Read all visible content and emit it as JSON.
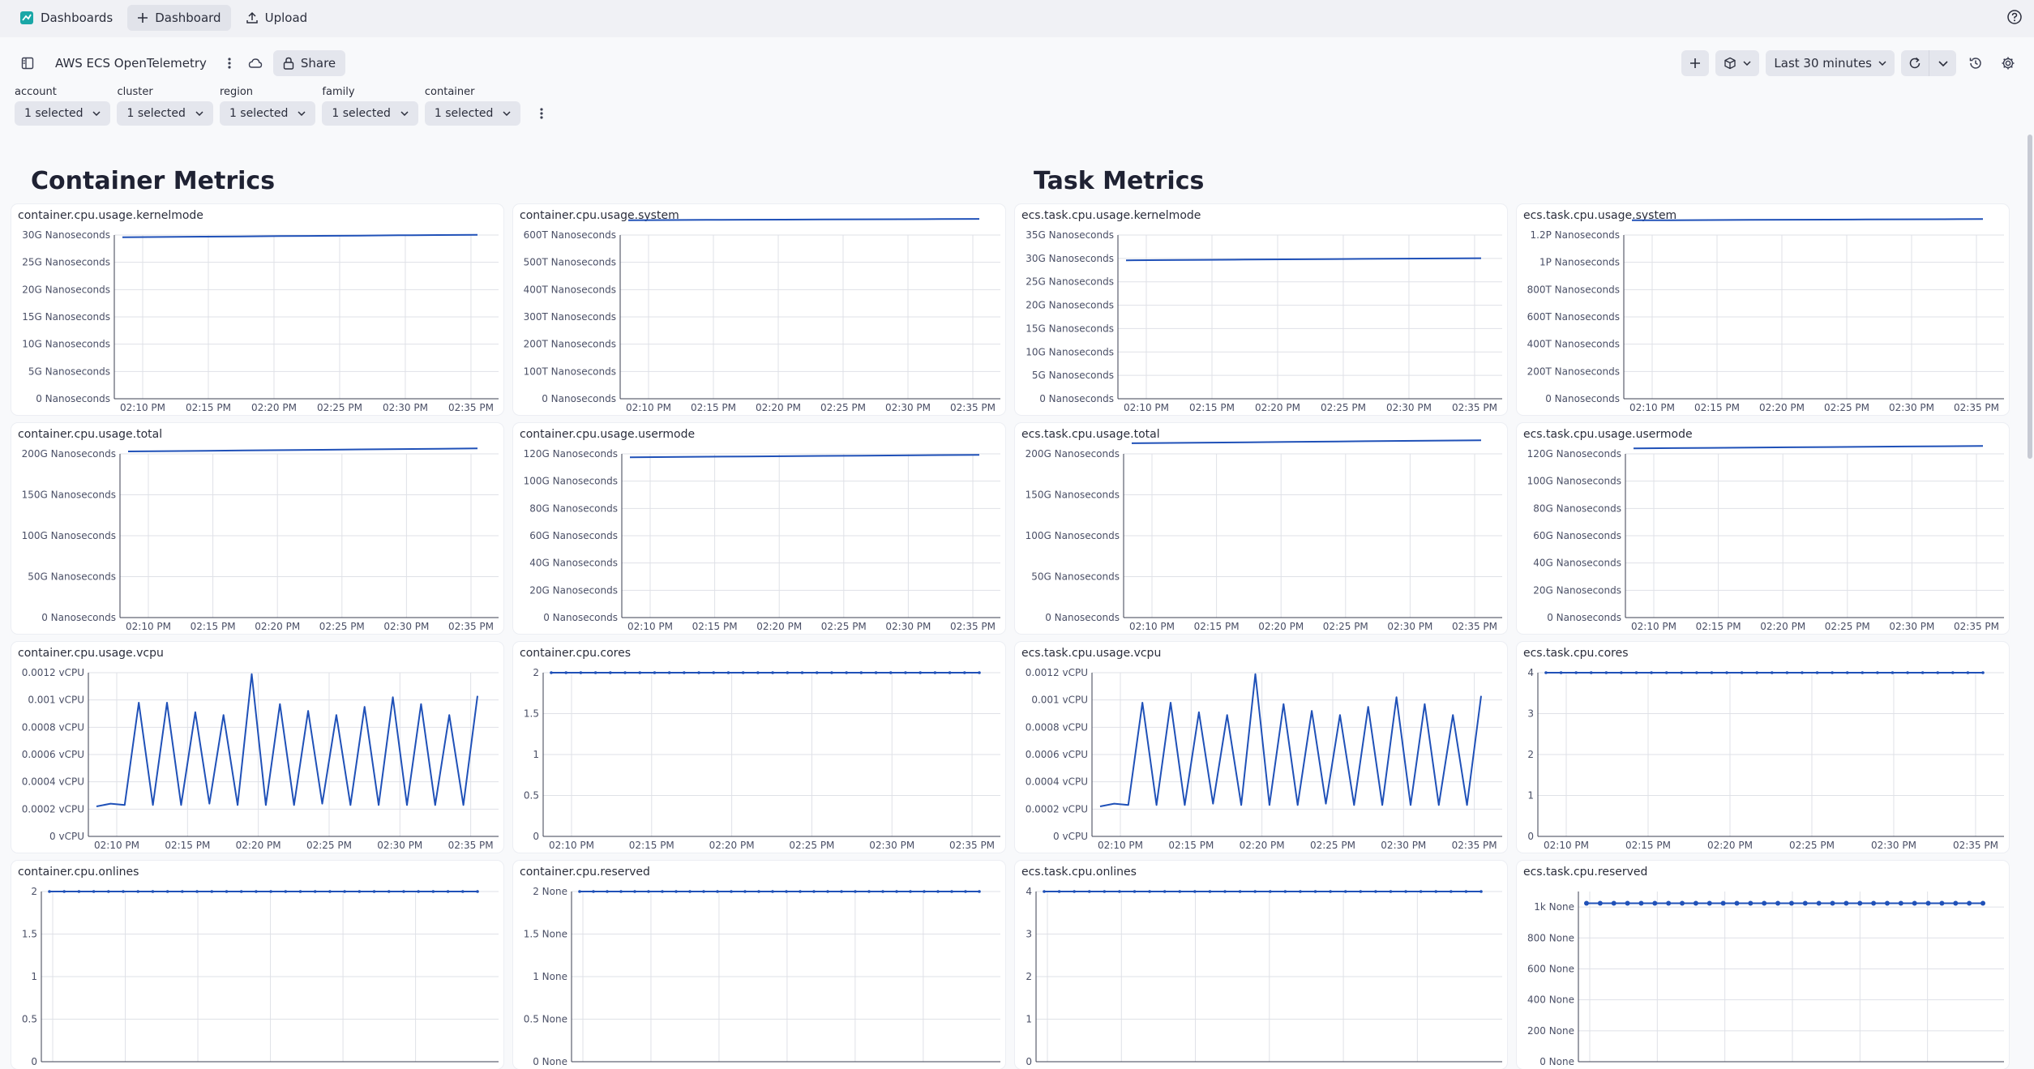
{
  "topbar": {
    "app_label": "Dashboards",
    "new_dashboard_label": "Dashboard",
    "upload_label": "Upload"
  },
  "dashboard": {
    "title": "AWS ECS OpenTelemetry",
    "share_label": "Share",
    "timeframe_label": "Last 30 minutes"
  },
  "variables": [
    {
      "name": "account",
      "value": "1 selected"
    },
    {
      "name": "cluster",
      "value": "1 selected"
    },
    {
      "name": "region",
      "value": "1 selected"
    },
    {
      "name": "family",
      "value": "1 selected"
    },
    {
      "name": "container",
      "value": "1 selected"
    }
  ],
  "sections": {
    "container": "Container Metrics",
    "task": "Task Metrics"
  },
  "colors": {
    "series": "#2051b8",
    "grid": "#dfe1e7",
    "axis": "#3b3f52",
    "label": "#4a4f66"
  },
  "chart_data": [
    {
      "id": "c1",
      "title": "container.cpu.usage.kernelmode",
      "type": "line",
      "xmode": "std",
      "ylim": [
        0,
        30
      ],
      "yticks": [
        0,
        5,
        10,
        15,
        20,
        25,
        30
      ],
      "ytick_labels": [
        "0 Nanoseconds",
        "5G Nanoseconds",
        "10G Nanoseconds",
        "15G Nanoseconds",
        "20G Nanoseconds",
        "25G Nanoseconds",
        "30G Nanoseconds"
      ],
      "xtick_labels": [
        "02:10 PM",
        "02:15 PM",
        "02:20 PM",
        "02:25 PM",
        "02:30 PM",
        "02:35 PM"
      ],
      "series": [
        {
          "values": [
            29.6,
            29.65,
            29.7,
            29.75,
            29.8,
            29.85,
            29.9,
            29.95,
            30.0,
            30.05
          ]
        }
      ]
    },
    {
      "id": "c2",
      "title": "container.cpu.usage.system",
      "type": "line",
      "xmode": "std",
      "ylim": [
        0,
        600
      ],
      "yticks": [
        0,
        100,
        200,
        300,
        400,
        500,
        600
      ],
      "ytick_labels": [
        "0 Nanoseconds",
        "100T Nanoseconds",
        "200T Nanoseconds",
        "300T Nanoseconds",
        "400T Nanoseconds",
        "500T Nanoseconds",
        "600T Nanoseconds"
      ],
      "xtick_labels": [
        "02:10 PM",
        "02:15 PM",
        "02:20 PM",
        "02:25 PM",
        "02:30 PM",
        "02:35 PM"
      ],
      "series": [
        {
          "values": [
            654,
            655,
            655.5,
            656,
            656.5,
            657,
            657.5,
            658,
            658.5,
            659
          ]
        }
      ]
    },
    {
      "id": "t1",
      "title": "ecs.task.cpu.usage.kernelmode",
      "type": "line",
      "xmode": "std",
      "ylim": [
        0,
        35
      ],
      "yticks": [
        0,
        5,
        10,
        15,
        20,
        25,
        30,
        35
      ],
      "ytick_labels": [
        "0 Nanoseconds",
        "5G Nanoseconds",
        "10G Nanoseconds",
        "15G Nanoseconds",
        "20G Nanoseconds",
        "25G Nanoseconds",
        "30G Nanoseconds",
        "35G Nanoseconds"
      ],
      "xtick_labels": [
        "02:10 PM",
        "02:15 PM",
        "02:20 PM",
        "02:25 PM",
        "02:30 PM",
        "02:35 PM"
      ],
      "series": [
        {
          "values": [
            29.6,
            29.65,
            29.7,
            29.75,
            29.8,
            29.85,
            29.9,
            29.95,
            30.0,
            30.05
          ]
        }
      ]
    },
    {
      "id": "t2",
      "title": "ecs.task.cpu.usage.system",
      "type": "line",
      "xmode": "std",
      "ylim": [
        0,
        1200
      ],
      "yticks": [
        0,
        200,
        400,
        600,
        800,
        1000,
        1200
      ],
      "ytick_labels": [
        "0 Nanoseconds",
        "200T Nanoseconds",
        "400T Nanoseconds",
        "600T Nanoseconds",
        "800T Nanoseconds",
        "1P Nanoseconds",
        "1.2P Nanoseconds"
      ],
      "xtick_labels": [
        "02:10 PM",
        "02:15 PM",
        "02:20 PM",
        "02:25 PM",
        "02:30 PM",
        "02:35 PM"
      ],
      "series": [
        {
          "values": [
            1308,
            1309,
            1310,
            1311,
            1312,
            1313,
            1314,
            1315,
            1316,
            1317
          ]
        }
      ]
    },
    {
      "id": "c3",
      "title": "container.cpu.usage.total",
      "type": "line",
      "xmode": "std",
      "ylim": [
        0,
        200
      ],
      "yticks": [
        0,
        50,
        100,
        150,
        200
      ],
      "ytick_labels": [
        "0 Nanoseconds",
        "50G Nanoseconds",
        "100G Nanoseconds",
        "150G Nanoseconds",
        "200G Nanoseconds"
      ],
      "xtick_labels": [
        "02:10 PM",
        "02:15 PM",
        "02:20 PM",
        "02:25 PM",
        "02:30 PM",
        "02:35 PM"
      ],
      "series": [
        {
          "values": [
            203,
            203.4,
            203.8,
            204.2,
            204.6,
            205,
            205.4,
            205.8,
            206.2,
            206.6
          ]
        }
      ]
    },
    {
      "id": "c4",
      "title": "container.cpu.usage.usermode",
      "type": "line",
      "xmode": "std",
      "ylim": [
        0,
        120
      ],
      "yticks": [
        0,
        20,
        40,
        60,
        80,
        100,
        120
      ],
      "ytick_labels": [
        "0 Nanoseconds",
        "20G Nanoseconds",
        "40G Nanoseconds",
        "60G Nanoseconds",
        "80G Nanoseconds",
        "100G Nanoseconds",
        "120G Nanoseconds"
      ],
      "xtick_labels": [
        "02:10 PM",
        "02:15 PM",
        "02:20 PM",
        "02:25 PM",
        "02:30 PM",
        "02:35 PM"
      ],
      "series": [
        {
          "values": [
            117.5,
            117.7,
            117.9,
            118.1,
            118.3,
            118.5,
            118.7,
            118.9,
            119.1,
            119.3
          ]
        }
      ]
    },
    {
      "id": "t3",
      "title": "ecs.task.cpu.usage.total",
      "type": "line",
      "xmode": "std",
      "ylim": [
        0,
        200
      ],
      "yticks": [
        0,
        50,
        100,
        150,
        200
      ],
      "ytick_labels": [
        "0 Nanoseconds",
        "50G Nanoseconds",
        "100G Nanoseconds",
        "150G Nanoseconds",
        "200G Nanoseconds"
      ],
      "xtick_labels": [
        "02:10 PM",
        "02:15 PM",
        "02:20 PM",
        "02:25 PM",
        "02:30 PM",
        "02:35 PM"
      ],
      "series": [
        {
          "values": [
            213,
            213.4,
            213.8,
            214.2,
            214.6,
            215,
            215.4,
            215.8,
            216.2,
            216.6
          ]
        }
      ]
    },
    {
      "id": "t4",
      "title": "ecs.task.cpu.usage.usermode",
      "type": "line",
      "xmode": "std",
      "ylim": [
        0,
        120
      ],
      "yticks": [
        0,
        20,
        40,
        60,
        80,
        100,
        120
      ],
      "ytick_labels": [
        "0 Nanoseconds",
        "20G Nanoseconds",
        "40G Nanoseconds",
        "60G Nanoseconds",
        "80G Nanoseconds",
        "100G Nanoseconds",
        "120G Nanoseconds"
      ],
      "xtick_labels": [
        "02:10 PM",
        "02:15 PM",
        "02:20 PM",
        "02:25 PM",
        "02:30 PM",
        "02:35 PM"
      ],
      "series": [
        {
          "values": [
            124,
            124.2,
            124.4,
            124.6,
            124.8,
            125,
            125.2,
            125.4,
            125.6,
            125.8
          ]
        }
      ]
    },
    {
      "id": "c5",
      "title": "container.cpu.usage.vcpu",
      "type": "line",
      "xmode": "std",
      "ylim": [
        0,
        0.0012
      ],
      "yticks": [
        0,
        0.0002,
        0.0004,
        0.0006,
        0.0008,
        0.001,
        0.0012
      ],
      "ytick_labels": [
        "0 vCPU",
        "0.0002 vCPU",
        "0.0004 vCPU",
        "0.0006 vCPU",
        "0.0008 vCPU",
        "0.001 vCPU",
        "0.0012 vCPU"
      ],
      "xtick_labels": [
        "02:10 PM",
        "02:15 PM",
        "02:20 PM",
        "02:25 PM",
        "02:30 PM",
        "02:35 PM"
      ],
      "series": [
        {
          "values": [
            0.00022,
            0.00024,
            0.00023,
            0.00098,
            0.00023,
            0.00098,
            0.00023,
            0.00091,
            0.00024,
            0.00089,
            0.00023,
            0.00119,
            0.00023,
            0.00097,
            0.00023,
            0.00092,
            0.00024,
            0.00089,
            0.00023,
            0.00095,
            0.00023,
            0.00102,
            0.00023,
            0.00097,
            0.00023,
            0.00089,
            0.00023,
            0.00103
          ]
        }
      ]
    },
    {
      "id": "c6",
      "title": "container.cpu.cores",
      "type": "line",
      "xmode": "std",
      "markers": true,
      "ylim": [
        0,
        2
      ],
      "yticks": [
        0,
        0.5,
        1,
        1.5,
        2
      ],
      "ytick_labels": [
        "0",
        "0.5",
        "1",
        "1.5",
        "2"
      ],
      "xtick_labels": [
        "02:10 PM",
        "02:15 PM",
        "02:20 PM",
        "02:25 PM",
        "02:30 PM",
        "02:35 PM"
      ],
      "series": [
        {
          "values": [
            2,
            2,
            2,
            2,
            2,
            2,
            2,
            2,
            2,
            2,
            2,
            2,
            2,
            2,
            2,
            2,
            2,
            2,
            2,
            2,
            2,
            2,
            2,
            2,
            2,
            2,
            2,
            2,
            2,
            2
          ]
        }
      ]
    },
    {
      "id": "t5",
      "title": "ecs.task.cpu.usage.vcpu",
      "type": "line",
      "xmode": "std",
      "ylim": [
        0,
        0.0012
      ],
      "yticks": [
        0,
        0.0002,
        0.0004,
        0.0006,
        0.0008,
        0.001,
        0.0012
      ],
      "ytick_labels": [
        "0 vCPU",
        "0.0002 vCPU",
        "0.0004 vCPU",
        "0.0006 vCPU",
        "0.0008 vCPU",
        "0.001 vCPU",
        "0.0012 vCPU"
      ],
      "xtick_labels": [
        "02:10 PM",
        "02:15 PM",
        "02:20 PM",
        "02:25 PM",
        "02:30 PM",
        "02:35 PM"
      ],
      "series": [
        {
          "values": [
            0.00022,
            0.00024,
            0.00023,
            0.00098,
            0.00023,
            0.00098,
            0.00023,
            0.00091,
            0.00024,
            0.00089,
            0.00023,
            0.00119,
            0.00023,
            0.00097,
            0.00023,
            0.00092,
            0.00024,
            0.00089,
            0.00023,
            0.00095,
            0.00023,
            0.00102,
            0.00023,
            0.00097,
            0.00023,
            0.00089,
            0.00023,
            0.00103
          ]
        }
      ]
    },
    {
      "id": "t6",
      "title": "ecs.task.cpu.cores",
      "type": "line",
      "xmode": "std",
      "markers": true,
      "ylim": [
        0,
        4
      ],
      "yticks": [
        0,
        1,
        2,
        3,
        4
      ],
      "ytick_labels": [
        "0",
        "1",
        "2",
        "3",
        "4"
      ],
      "xtick_labels": [
        "02:10 PM",
        "02:15 PM",
        "02:20 PM",
        "02:25 PM",
        "02:30 PM",
        "02:35 PM"
      ],
      "series": [
        {
          "values": [
            4,
            4,
            4,
            4,
            4,
            4,
            4,
            4,
            4,
            4,
            4,
            4,
            4,
            4,
            4,
            4,
            4,
            4,
            4,
            4,
            4,
            4,
            4,
            4,
            4,
            4,
            4,
            4,
            4,
            4
          ]
        }
      ]
    },
    {
      "id": "c7",
      "title": "container.cpu.onlines",
      "type": "line",
      "xmode": "wide",
      "markers": true,
      "ylim": [
        0,
        2
      ],
      "yticks": [
        0,
        0.5,
        1,
        1.5,
        2
      ],
      "ytick_labels": [
        "0",
        "0.5",
        "1",
        "1.5",
        "2"
      ],
      "series": [
        {
          "values": [
            2,
            2,
            2,
            2,
            2,
            2,
            2,
            2,
            2,
            2,
            2,
            2,
            2,
            2,
            2,
            2,
            2,
            2,
            2,
            2,
            2,
            2,
            2,
            2,
            2,
            2,
            2,
            2,
            2,
            2
          ]
        }
      ]
    },
    {
      "id": "c8",
      "title": "container.cpu.reserved",
      "type": "line",
      "xmode": "wide",
      "markers": true,
      "ylim": [
        0,
        2
      ],
      "yticks": [
        0,
        0.5,
        1,
        1.5,
        2
      ],
      "ytick_labels": [
        "0 None",
        "0.5 None",
        "1 None",
        "1.5 None",
        "2 None"
      ],
      "series": [
        {
          "values": [
            2,
            2,
            2,
            2,
            2,
            2,
            2,
            2,
            2,
            2,
            2,
            2,
            2,
            2,
            2,
            2,
            2,
            2,
            2,
            2,
            2,
            2,
            2,
            2,
            2,
            2,
            2,
            2,
            2,
            2
          ]
        }
      ]
    },
    {
      "id": "t7",
      "title": "ecs.task.cpu.onlines",
      "type": "line",
      "xmode": "wide",
      "markers": true,
      "ylim": [
        0,
        4
      ],
      "yticks": [
        0,
        1,
        2,
        3,
        4
      ],
      "ytick_labels": [
        "0",
        "1",
        "2",
        "3",
        "4"
      ],
      "series": [
        {
          "values": [
            4,
            4,
            4,
            4,
            4,
            4,
            4,
            4,
            4,
            4,
            4,
            4,
            4,
            4,
            4,
            4,
            4,
            4,
            4,
            4,
            4,
            4,
            4,
            4,
            4,
            4,
            4,
            4,
            4,
            4
          ]
        }
      ]
    },
    {
      "id": "t8",
      "title": "ecs.task.cpu.reserved",
      "type": "line",
      "xmode": "wide",
      "markers": true,
      "ylim": [
        0,
        1100
      ],
      "yticks": [
        0,
        200,
        400,
        600,
        800,
        1000
      ],
      "ytick_labels": [
        "0 None",
        "200 None",
        "400 None",
        "600 None",
        "800 None",
        "1k None"
      ],
      "series": [
        {
          "values": [
            1024,
            1024,
            1024,
            1024,
            1024,
            1024,
            1024,
            1024,
            1024,
            1024,
            1024,
            1024,
            1024,
            1024,
            1024,
            1024,
            1024,
            1024,
            1024,
            1024,
            1024,
            1024,
            1024,
            1024,
            1024,
            1024,
            1024,
            1024,
            1024,
            1024
          ]
        }
      ]
    }
  ]
}
